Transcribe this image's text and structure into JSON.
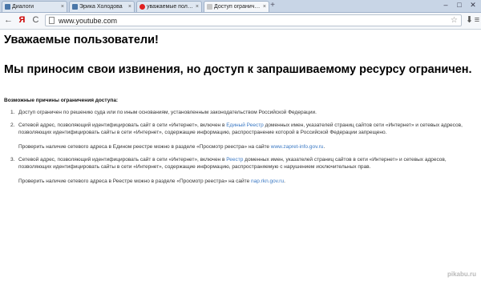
{
  "browser": {
    "tabs": [
      {
        "label": "Диалоги",
        "favicon_color": "#4a76a8",
        "active": false
      },
      {
        "label": "Эрика Холодова",
        "favicon_color": "#4a76a8",
        "active": false
      },
      {
        "label": "уважаемые пользо",
        "favicon_color": "#e02020",
        "active": false
      },
      {
        "label": "Доступ ограничен",
        "favicon_color": "#c8c8c8",
        "active": true
      }
    ],
    "new_tab_symbol": "+",
    "window_controls": {
      "minimize": "–",
      "maximize": "□",
      "close": "✕"
    },
    "url": "www.youtube.com",
    "back_symbol": "←",
    "yandex_symbol": "Я",
    "reload_symbol": "C",
    "star_symbol": "☆",
    "download_symbol": "⬇",
    "menu_symbol": "≡"
  },
  "page": {
    "heading1": "Уважаемые пользователи!",
    "heading2": "Мы приносим свои извинения, но доступ к запрашиваемому ресурсу ограничен.",
    "reasons_title": "Возможные причины ограничения доступа:",
    "reasons": [
      {
        "num": "1.",
        "text": "Доступ ограничен по решению суда или по иным основаниям, установленным законодательством Российской Федерации."
      },
      {
        "num": "2.",
        "text_a": "Сетевой адрес, позволяющий идентифицировать сайт в сети «Интернет», включен в ",
        "link": "Единый Реестр",
        "text_b": " доменных имен, указателей страниц сайтов сети «Интернет» и сетевых адресов, позволяющих идентифицировать сайты в сети «Интернет», содержащие информацию, распространение которой в Российской Федерации запрещено.",
        "check_text": "Проверить наличие сетевого адреса в Едином реестре можно в разделе «Просмотр реестра» на сайте ",
        "check_link": "www.zapret-info.gov.ru",
        "check_end": "."
      },
      {
        "num": "3.",
        "text_a": "Сетевой адрес, позволяющий идентифицировать сайт в сети «Интернет», включен в ",
        "link": "Реестр",
        "text_b": " доменных имен, указателей страниц сайтов в сети «Интернет» и сетевых адресов, позволяющих идентифицировать сайты в сети «Интернет», содержащие информацию, распространяемую с нарушением исключительных прав.",
        "check_text": "Проверить наличие сетевого адреса в Реестре можно в разделе «Просмотр реестра» на сайте ",
        "check_link": "nap.rkn.gov.ru",
        "check_end": "."
      }
    ],
    "watermark": "pikabu.ru"
  }
}
